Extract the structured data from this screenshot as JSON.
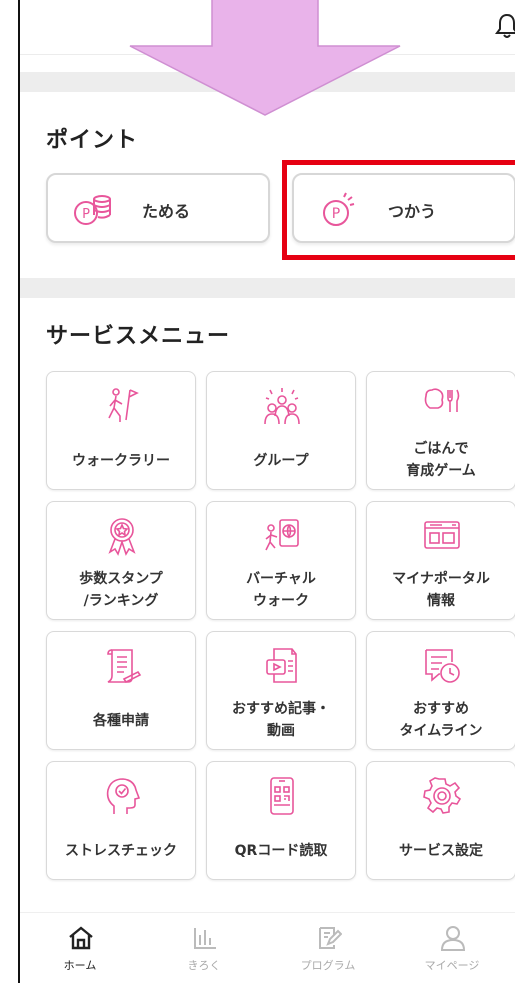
{
  "colors": {
    "accent": "#e8569b",
    "arrow": "#e9b3ea",
    "highlight": "#e60012",
    "tile_border": "#d9d9d9"
  },
  "point": {
    "title": "ポイント",
    "buttons": [
      {
        "label": "ためる",
        "icon": "coin-stack-icon"
      },
      {
        "label": "つかう",
        "icon": "point-use-icon"
      }
    ]
  },
  "services": {
    "title": "サービスメニュー",
    "items": [
      {
        "label": "ウォークラリー",
        "icon": "walk-rally-icon"
      },
      {
        "label": "グループ",
        "icon": "group-icon"
      },
      {
        "label": "ごはんで\n育成ゲーム",
        "icon": "meal-game-icon"
      },
      {
        "label": "歩数スタンプ\n/ランキング",
        "icon": "ranking-medal-icon"
      },
      {
        "label": "バーチャル\nウォーク",
        "icon": "virtual-walk-icon"
      },
      {
        "label": "マイナポータル\n情報",
        "icon": "mynaportal-icon"
      },
      {
        "label": "各種申請",
        "icon": "document-icon"
      },
      {
        "label": "おすすめ記事・\n動画",
        "icon": "article-video-icon"
      },
      {
        "label": "おすすめ\nタイムライン",
        "icon": "timeline-icon"
      },
      {
        "label": "ストレスチェック",
        "icon": "stress-check-icon"
      },
      {
        "label": "QRコード読取",
        "icon": "qr-reader-icon"
      },
      {
        "label": "サービス設定",
        "icon": "settings-gear-icon"
      }
    ]
  },
  "tabbar": {
    "tabs": [
      {
        "label": "ホーム",
        "icon": "home-icon",
        "active": true
      },
      {
        "label": "きろく",
        "icon": "chart-icon",
        "active": false
      },
      {
        "label": "プログラム",
        "icon": "program-icon",
        "active": false
      },
      {
        "label": "マイページ",
        "icon": "user-icon",
        "active": false
      }
    ]
  }
}
